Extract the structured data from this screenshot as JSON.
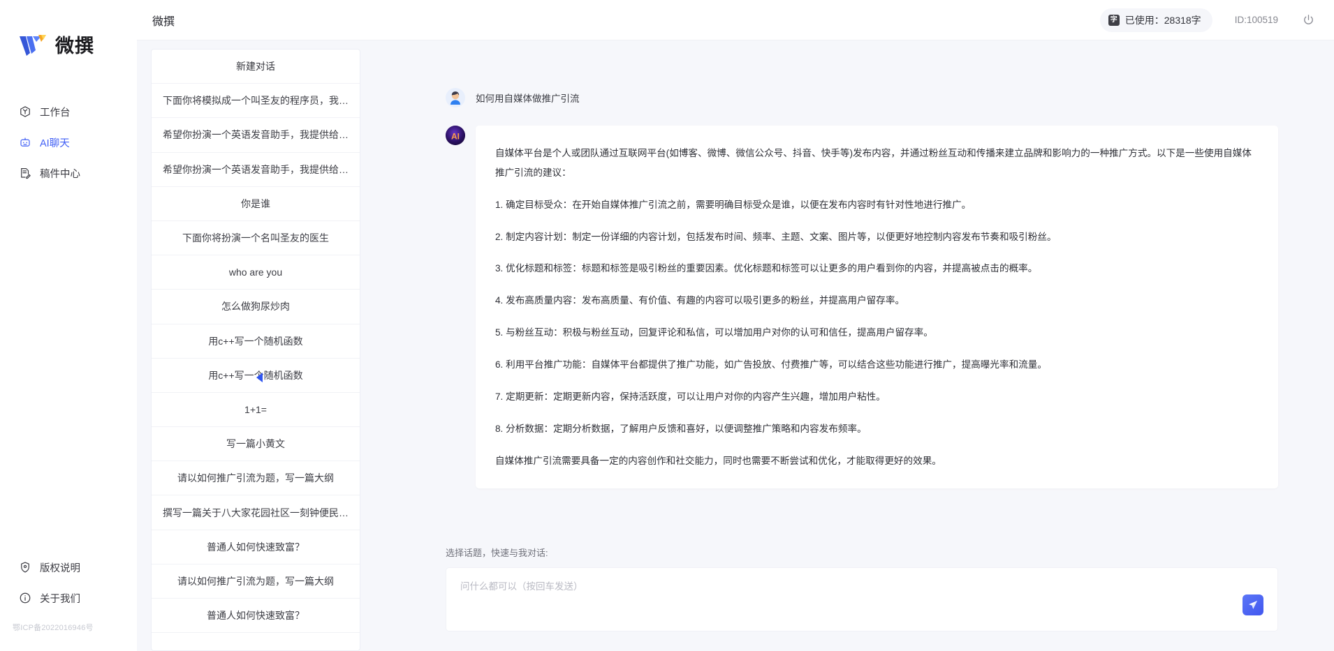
{
  "brand": {
    "name": "微撰",
    "logo_icon": "w-logo-icon"
  },
  "sidebar": {
    "items": [
      {
        "label": "工作台",
        "icon": "workbench-icon",
        "active": false
      },
      {
        "label": "AI聊天",
        "icon": "robot-icon",
        "active": true
      },
      {
        "label": "稿件中心",
        "icon": "document-edit-icon",
        "active": false
      }
    ],
    "bottom_items": [
      {
        "label": "版权说明",
        "icon": "shield-icon"
      },
      {
        "label": "关于我们",
        "icon": "info-icon"
      }
    ],
    "icp": "鄂ICP备2022016946号"
  },
  "topbar": {
    "title": "微撰",
    "usage_badge": "字",
    "usage_label": "已使用：28318字",
    "user_id": "ID:100519",
    "power_icon": "power-icon"
  },
  "conversations": {
    "new_label": "新建对话",
    "collapse_icon": "chevron-left-icon",
    "items": [
      "下面你将模拟成一个叫圣友的程序员，我说...",
      "希望你扮演一个英语发音助手，我提供给你...",
      "希望你扮演一个英语发音助手，我提供给你...",
      "你是谁",
      "下面你将扮演一个名叫圣友的医生",
      "who are you",
      "怎么做狗尿炒肉",
      "用c++写一个随机函数",
      "用c++写一个随机函数",
      "1+1=",
      "写一篇小黄文",
      "请以如何推广引流为题，写一篇大纲",
      "撰写一篇关于八大家花园社区一刻钟便民生...",
      "普通人如何快速致富？",
      "请以如何推广引流为题，写一篇大纲",
      "普通人如何快速致富？"
    ]
  },
  "chat": {
    "user_avatar_icon": "user-avatar-icon",
    "ai_avatar_icon": "ai-avatar-icon",
    "user_message": "如何用自媒体做推广引流",
    "ai_paragraphs": [
      "自媒体平台是个人或团队通过互联网平台(如博客、微博、微信公众号、抖音、快手等)发布内容，并通过粉丝互动和传播来建立品牌和影响力的一种推广方式。以下是一些使用自媒体推广引流的建议：",
      "1. 确定目标受众：在开始自媒体推广引流之前，需要明确目标受众是谁，以便在发布内容时有针对性地进行推广。",
      "2. 制定内容计划：制定一份详细的内容计划，包括发布时间、频率、主题、文案、图片等，以便更好地控制内容发布节奏和吸引粉丝。",
      "3. 优化标题和标签：标题和标签是吸引粉丝的重要因素。优化标题和标签可以让更多的用户看到你的内容，并提高被点击的概率。",
      "4. 发布高质量内容：发布高质量、有价值、有趣的内容可以吸引更多的粉丝，并提高用户留存率。",
      "5. 与粉丝互动：积极与粉丝互动，回复评论和私信，可以增加用户对你的认可和信任，提高用户留存率。",
      "6. 利用平台推广功能：自媒体平台都提供了推广功能，如广告投放、付费推广等，可以结合这些功能进行推广，提高曝光率和流量。",
      "7. 定期更新：定期更新内容，保持活跃度，可以让用户对你的内容产生兴趣，增加用户粘性。",
      "8. 分析数据：定期分析数据，了解用户反馈和喜好，以便调整推广策略和内容发布频率。",
      "自媒体推广引流需要具备一定的内容创作和社交能力，同时也需要不断尝试和优化，才能取得更好的效果。"
    ]
  },
  "composer": {
    "label": "选择话题，快速与我对话:",
    "placeholder": "问什么都可以（按回车发送）",
    "value": "",
    "send_icon": "send-paper-plane-icon"
  },
  "colors": {
    "accent": "#4260f5",
    "page_bg": "#f6f7fb",
    "panel_bg": "#ffffff",
    "text": "#2f3037"
  }
}
